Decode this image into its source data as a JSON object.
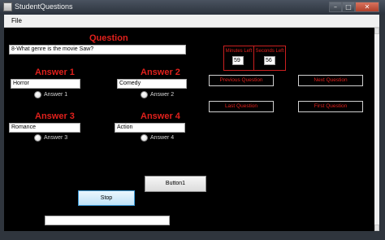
{
  "window": {
    "title": "StudentQuestions"
  },
  "menu": {
    "file": "File"
  },
  "question": {
    "heading": "Question",
    "text": "8-What genre is the movie Saw?"
  },
  "answers": [
    {
      "heading": "Answer 1",
      "value": "Horror",
      "radio_label": "Answer 1"
    },
    {
      "heading": "Answer 2",
      "value": "Comedy",
      "radio_label": "Answer 2"
    },
    {
      "heading": "Answer 3",
      "value": "Romance",
      "radio_label": "Answer 3"
    },
    {
      "heading": "Answer 4",
      "value": "Action",
      "radio_label": "Answer 4"
    }
  ],
  "timer": {
    "minutes_label": "Minutes Left",
    "minutes_value": "59",
    "seconds_label": "Seconds Left",
    "seconds_value": "56"
  },
  "nav": {
    "previous": "Previous Question",
    "next": "Next Question",
    "last": "Last Question",
    "first": "First Question"
  },
  "buttons": {
    "button1": "Button1",
    "stop": "Stop"
  },
  "status_field": {
    "value": ""
  },
  "colors": {
    "accent_red": "#e0201c",
    "background": "#000000"
  }
}
